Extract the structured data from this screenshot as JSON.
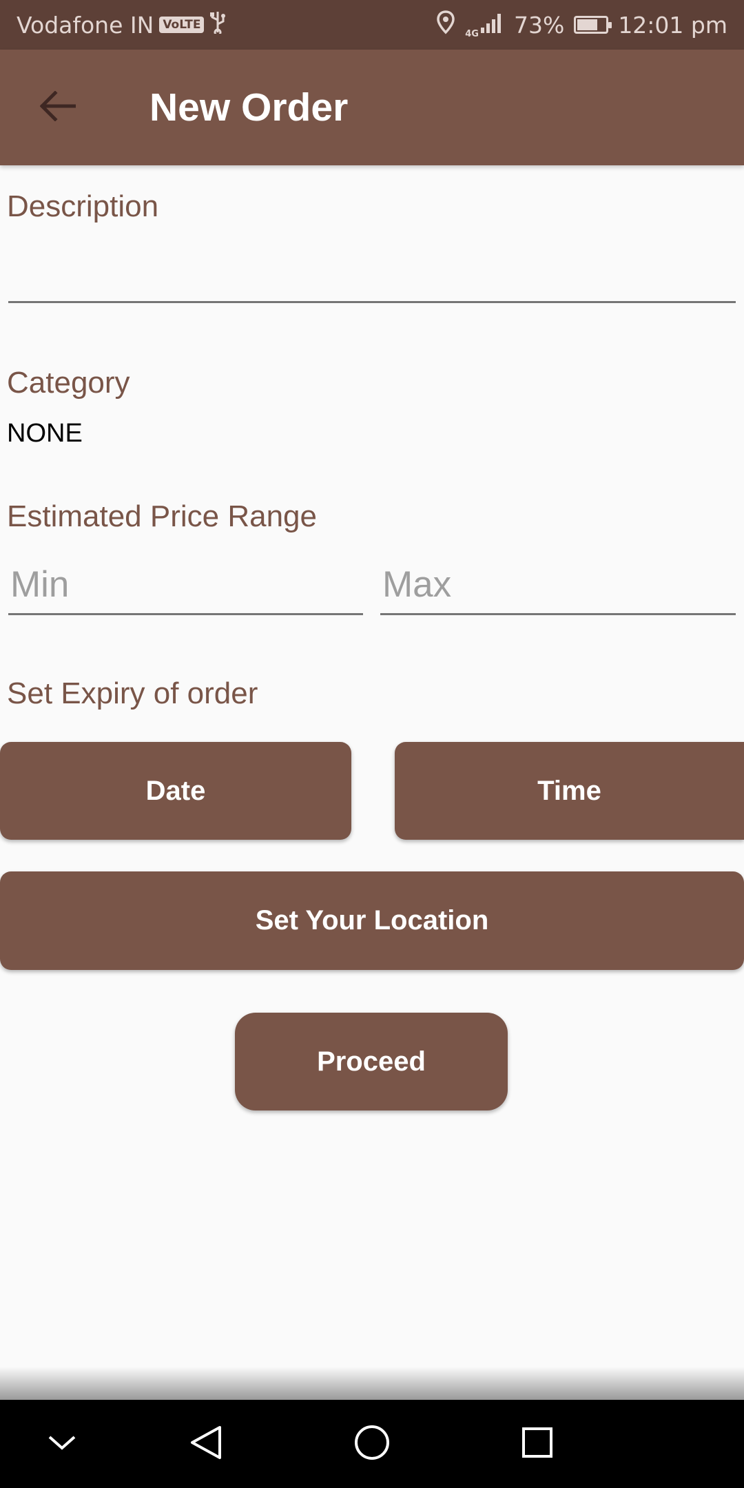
{
  "status_bar": {
    "carrier": "Vodafone IN",
    "volte": "VoLTE",
    "network": "4G",
    "battery": "73%",
    "battery_level": 0.73,
    "time": "12:01 pm"
  },
  "app_bar": {
    "title": "New Order",
    "back_icon": "arrow-back-icon"
  },
  "form": {
    "description_label": "Description",
    "description_value": "",
    "category_label": "Category",
    "category_value": "NONE",
    "price_label": "Estimated Price Range",
    "min_placeholder": "Min",
    "max_placeholder": "Max",
    "expiry_label": "Set Expiry of order"
  },
  "buttons": {
    "date": "Date",
    "time": "Time",
    "location": "Set Your Location",
    "proceed": "Proceed"
  },
  "nav_bar": {
    "icons": [
      "chevron-down-icon",
      "back-triangle-icon",
      "home-circle-icon",
      "recents-square-icon"
    ]
  },
  "colors": {
    "status_bar": "#5d4037",
    "primary": "#795548",
    "label": "#795548",
    "background": "#fafafa"
  }
}
